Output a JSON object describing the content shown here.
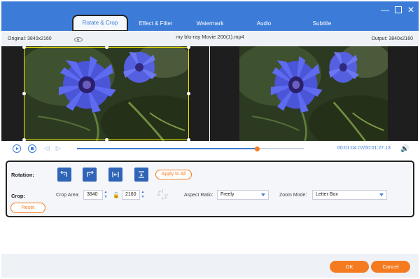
{
  "window": {
    "minimize_glyph": "—",
    "close_glyph": "✕"
  },
  "tabs": [
    {
      "label": "Rotate & Crop",
      "active": true
    },
    {
      "label": "Effect & Filter",
      "active": false
    },
    {
      "label": "Watermark",
      "active": false
    },
    {
      "label": "Audio",
      "active": false
    },
    {
      "label": "Subtitle",
      "active": false
    }
  ],
  "info": {
    "original": "Original: 3840x2160",
    "filename": "my blu-ray Movie 200(1).mp4",
    "output": "Output: 3840x2160"
  },
  "player": {
    "progress": 0.795,
    "time": "00:01:04.07/00:01:27.13",
    "skip_back": "◁|",
    "skip_forward": "|▷",
    "volume_glyph": "🔊"
  },
  "rotation": {
    "label": "Rotation:",
    "buttons": [
      "rotate-left",
      "rotate-right",
      "flip-horizontal",
      "flip-vertical"
    ],
    "apply_all": "Apply to All"
  },
  "crop": {
    "label": "Crop:",
    "area_label": "Crop Area:",
    "width": "3840",
    "height": "2160",
    "aspect_label": "Aspect Ratio:",
    "aspect_value": "Freely",
    "zoom_label": "Zoom Mode:",
    "zoom_value": "Letter Box",
    "reset": "Reset"
  },
  "footer": {
    "ok": "OK",
    "cancel": "Cancel"
  },
  "colors": {
    "accent": "#3c7cd8",
    "orange": "#f47b20",
    "crop": "#f2e600"
  }
}
